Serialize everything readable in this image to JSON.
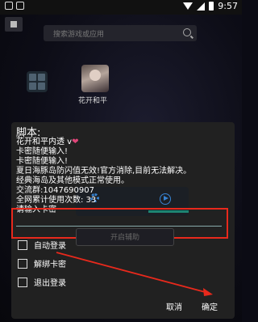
{
  "statusbar": {
    "time": "9:57"
  },
  "search": {
    "placeholder": "搜索游戏或应用"
  },
  "app_tile": {
    "label": "花开和平"
  },
  "dialog": {
    "title": "脚本:",
    "lines": [
      "花开和平内透 v",
      "卡密随便输入!",
      "卡密随便输入!",
      "夏日海豚岛防闪值无效!官方消除,目前无法解决。",
      "经典海岛及其他模式正常使用。",
      "交流群:1047690907",
      "全网累计使用次数: 33",
      "请输入卡密"
    ],
    "assist_button": "开启辅助",
    "checkboxes": [
      "自动登录",
      "解绑卡密",
      "退出登录"
    ],
    "cancel": "取消",
    "confirm": "确定"
  },
  "annotation_color": "#e8291c"
}
